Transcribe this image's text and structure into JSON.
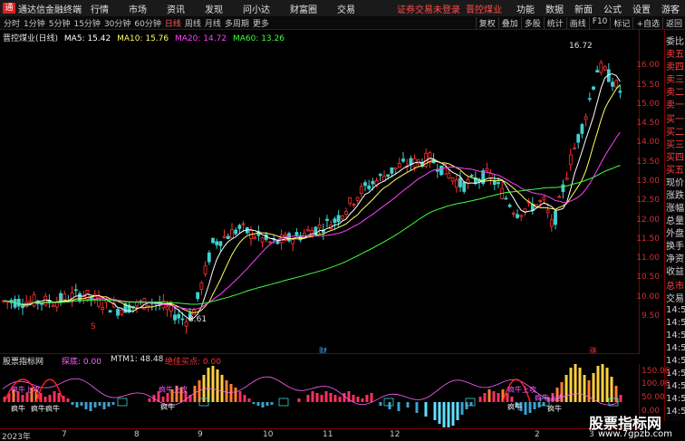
{
  "titlebar": {
    "logo": "通",
    "app_title": "通达信金融终端",
    "menu": [
      "行情",
      "市场",
      "资讯",
      "发现",
      "问小达",
      "财富圈",
      "交易"
    ],
    "login_link": "证券交易未登录",
    "stock_link": "晋控煤业",
    "right_items": [
      "功能",
      "数据",
      "新面",
      "公式",
      "设置",
      "游客"
    ]
  },
  "period_bar": {
    "periods": [
      "分时",
      "1分钟",
      "5分钟",
      "15分钟",
      "30分钟",
      "60分钟",
      "日线",
      "周线",
      "月线",
      "多周期",
      "更多"
    ],
    "active_period": "日线",
    "buttons": [
      "复权",
      "叠加",
      "多股",
      "统计",
      "画线",
      "F10",
      "标记",
      "+自选",
      "返回"
    ]
  },
  "ma_header": {
    "name": "晋控煤业(日线)",
    "ma5_label": "MA5: 15.42",
    "ma10_label": "MA10: 15.76",
    "ma20_label": "MA20: 14.72",
    "ma60_label": "MA60: 13.26"
  },
  "colors": {
    "up": "#ff3030",
    "down": "#40d0d0",
    "ma5": "#ffffff",
    "ma10": "#ffff60",
    "ma20": "#ff40ff",
    "ma60": "#40ff40"
  },
  "price_axis": [
    "16.00",
    "15.50",
    "15.00",
    "14.50",
    "14.00",
    "13.50",
    "13.00",
    "12.50",
    "12.00",
    "11.50",
    "11.00",
    "10.50",
    "10.00",
    "9.50"
  ],
  "price_markers": {
    "high": "16.72",
    "low": "8.61",
    "marker_left": "S",
    "marker_mid": "财",
    "marker_right": "涨"
  },
  "right_panel": [
    "委比",
    "卖五",
    "卖四",
    "卖三",
    "卖二",
    "卖一",
    "买一",
    "买二",
    "买三",
    "买四",
    "买五",
    "现价",
    "涨跌",
    "涨幅",
    "总量",
    "外盘",
    "换手",
    "净资",
    "收益",
    "总市",
    "交易",
    "14:5",
    "14:5",
    "14:5",
    "14:5",
    "14:5",
    "14:5",
    "14:5",
    "14:5",
    "14:5",
    "14:5",
    "14:5"
  ],
  "indicator": {
    "name": "股票指标网",
    "l1": "探底: 0.00",
    "l2": "MTM1: 48.48",
    "l3": "绝佳买点: 0.00",
    "axis": [
      "150.00",
      "100.00",
      "50.00",
      "0.00"
    ],
    "labels_top": [
      "疯牛上攻",
      "疯牛上攻",
      "疯牛上攻",
      "疯牛上攻"
    ],
    "labels_bottom": [
      "疯牛",
      "疯牛疯牛",
      "疯牛",
      "疯牛",
      "疯牛"
    ]
  },
  "date_axis": [
    "2023年",
    "7",
    "8",
    "9",
    "10",
    "11",
    "12",
    "2",
    "3"
  ],
  "watermark": {
    "title": "股票指标网",
    "url": "www.7gpzb.com"
  }
}
